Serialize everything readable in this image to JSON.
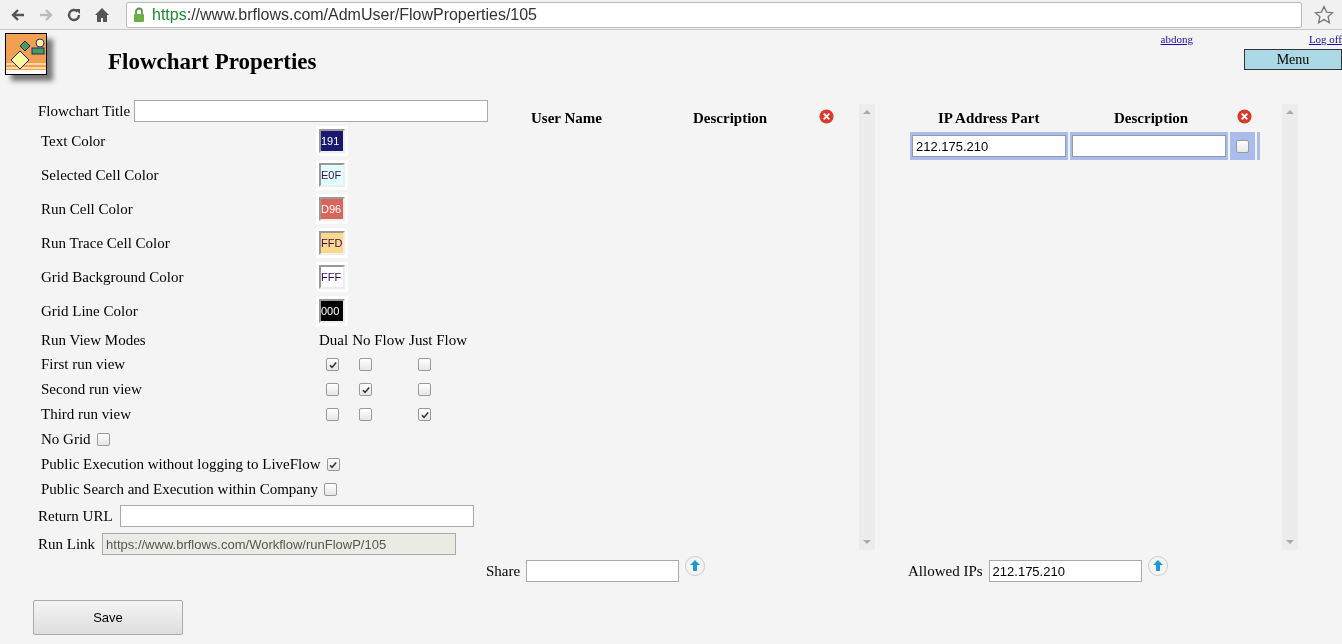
{
  "browser": {
    "url_scheme": "https",
    "url_rest": "://www.brflows.com/AdmUser/FlowProperties/105",
    "forward_disabled": true
  },
  "header": {
    "title": "Flowchart Properties",
    "user_link": "abdong",
    "logoff_link": "Log off",
    "menu_button": "Menu"
  },
  "form": {
    "title_label": "Flowchart Title",
    "colors": [
      {
        "label": "Text Color",
        "value": "191",
        "color": "#191970"
      },
      {
        "label": "Selected Cell Color",
        "value": "E0F",
        "color": "#e0ffff"
      },
      {
        "label": "Run Cell Color",
        "value": "D96",
        "color": "#d9665a"
      },
      {
        "label": "Run Trace Cell Color",
        "value": "FFD",
        "color": "#ffd98a"
      },
      {
        "label": "Grid Background Color",
        "value": "FFF",
        "color": "#ffffff"
      },
      {
        "label": "Grid Line Color",
        "value": "000",
        "color": "#000000"
      }
    ],
    "run_view": {
      "label": "Run View Modes",
      "modes": [
        "Dual",
        "No Flow",
        "Just Flow"
      ],
      "rows": [
        {
          "label": "First run view",
          "checks": [
            true,
            false,
            false
          ]
        },
        {
          "label": "Second run view",
          "checks": [
            false,
            true,
            false
          ]
        },
        {
          "label": "Third run view",
          "checks": [
            false,
            false,
            true
          ]
        }
      ]
    },
    "options": [
      {
        "label": "No Grid",
        "checked": false
      },
      {
        "label": "Public Execution without logging to LiveFlow",
        "checked": true
      },
      {
        "label": "Public Search and Execution within Company",
        "checked": false
      }
    ],
    "return_url_label": "Return URL",
    "run_link_label": "Run Link",
    "run_link_value": "https://www.brflows.com/Workflow/runFlowP/105"
  },
  "users": {
    "columns": [
      "User Name",
      "Description"
    ],
    "share_label": "Share"
  },
  "ips": {
    "columns": [
      "IP Address Part",
      "Description"
    ],
    "rows": [
      {
        "ip": "212.175.210",
        "checked": false
      }
    ],
    "allowed_label": "Allowed IPs",
    "allowed_value": "212.175.210"
  },
  "save_button": "Save"
}
